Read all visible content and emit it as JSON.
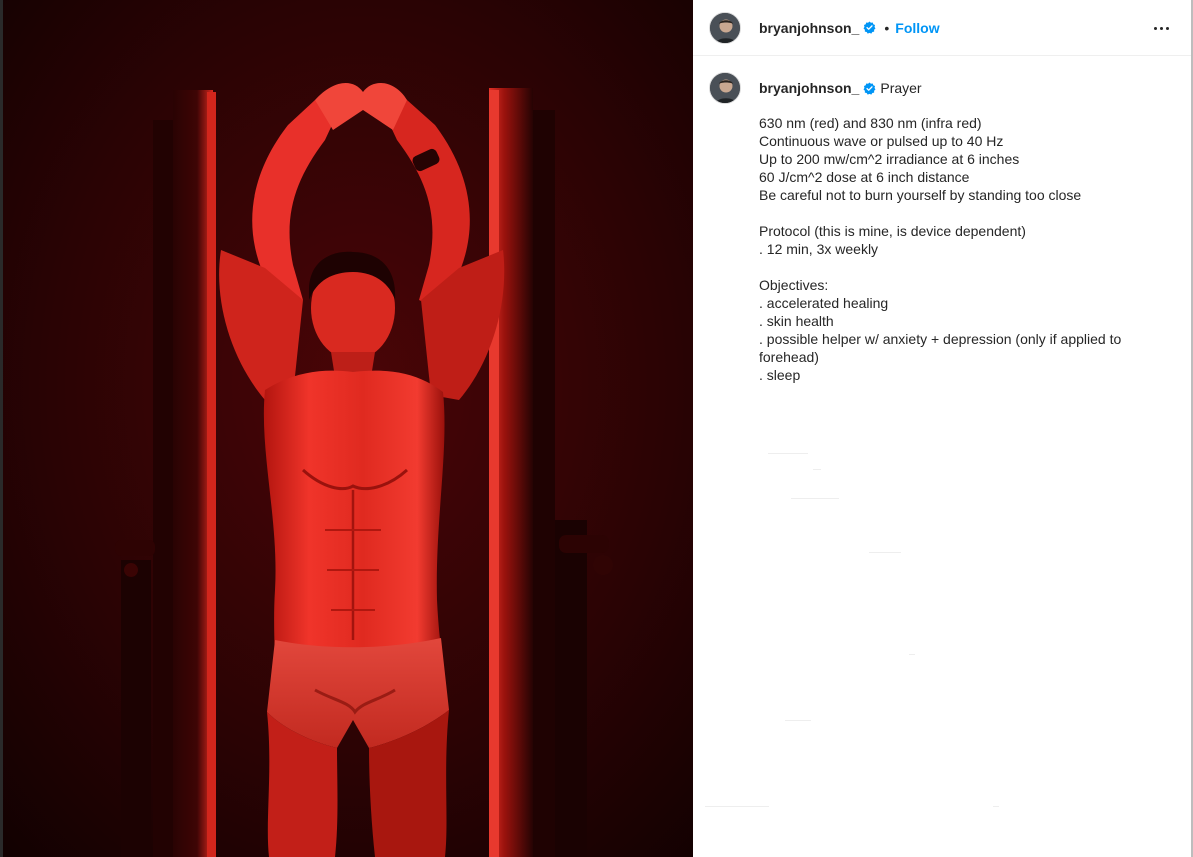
{
  "header": {
    "username": "bryanjohnson_",
    "separator": "•",
    "follow_label": "Follow"
  },
  "caption": {
    "username": "bryanjohnson_",
    "title": "Prayer",
    "lines": [
      "630 nm (red) and 830 nm (infra red)",
      "Continuous wave or pulsed up to 40 Hz",
      "Up to 200 mw/cm^2 irradiance at 6 inches",
      "60 J/cm^2 dose at 6 inch distance",
      "Be careful not to burn yourself by standing too close",
      "",
      "Protocol (this is mine, is device dependent)",
      ". 12 min, 3x weekly",
      "",
      "Objectives:",
      ". accelerated healing",
      ". skin health",
      ". possible helper w/ anxiety + depression (only if applied to",
      "forehead)",
      ". sleep"
    ]
  },
  "colors": {
    "accent": "#0095f6",
    "verified": "#0095f6",
    "text": "#262626",
    "photo_red": "#d0221c"
  },
  "icons": {
    "verified": "verified-badge-icon",
    "more": "more-options-icon"
  }
}
